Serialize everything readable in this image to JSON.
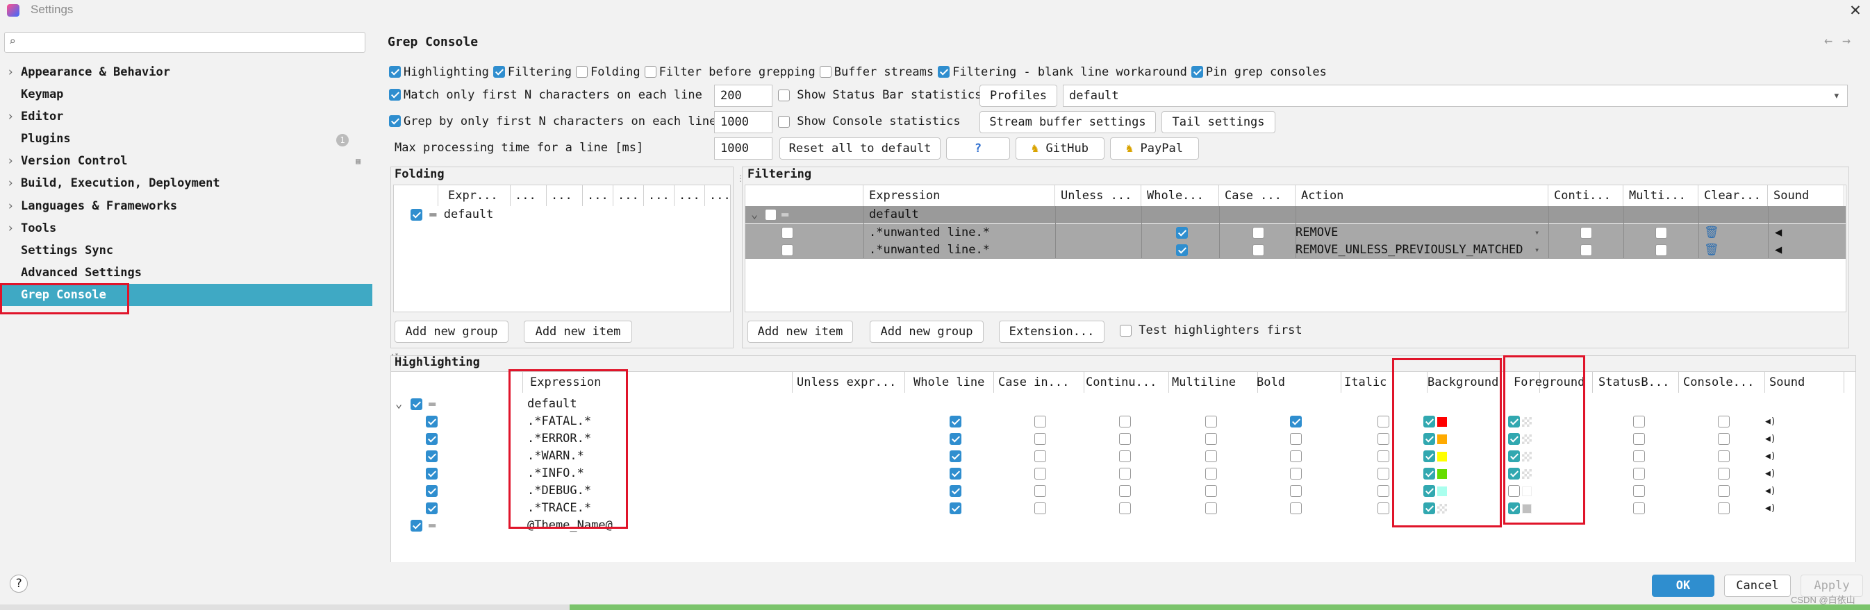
{
  "window": {
    "title": "Settings",
    "close": "✕"
  },
  "sidebar": {
    "search_placeholder": "",
    "items": [
      {
        "label": "Appearance & Behavior",
        "expandable": true
      },
      {
        "label": "Keymap",
        "expandable": false
      },
      {
        "label": "Editor",
        "expandable": true
      },
      {
        "label": "Plugins",
        "expandable": false,
        "badge": "1"
      },
      {
        "label": "Version Control",
        "expandable": true
      },
      {
        "label": "Build, Execution, Deployment",
        "expandable": true
      },
      {
        "label": "Languages & Frameworks",
        "expandable": true
      },
      {
        "label": "Tools",
        "expandable": true
      },
      {
        "label": "Settings Sync",
        "expandable": false
      },
      {
        "label": "Advanced Settings",
        "expandable": false
      },
      {
        "label": "Grep Console",
        "expandable": false,
        "selected": true
      }
    ]
  },
  "page": {
    "title": "Grep Console",
    "back": "←",
    "forward": "→"
  },
  "options": {
    "row1": [
      {
        "label": "Highlighting",
        "checked": true
      },
      {
        "label": "Filtering",
        "checked": true
      },
      {
        "label": "Folding",
        "checked": false
      },
      {
        "label": "Filter before grepping",
        "checked": false
      },
      {
        "label": "Buffer streams",
        "checked": false
      },
      {
        "label": "Filtering - blank line workaround",
        "checked": true
      },
      {
        "label": "Pin grep consoles",
        "checked": true
      }
    ],
    "match_first_n": {
      "label": "Match only first N characters on each line",
      "checked": true,
      "value": "200"
    },
    "grep_first_n": {
      "label": "Grep by only first N characters on each line",
      "checked": true,
      "value": "1000"
    },
    "max_time": {
      "label": "Max processing time for a line [ms]",
      "value": "1000"
    },
    "status_bar_stats": {
      "label": "Show Status Bar statistics",
      "checked": false
    },
    "console_stats": {
      "label": "Show Console statistics",
      "checked": false
    },
    "profiles_label": "Profiles",
    "profile_value": "default",
    "stream_buffer_btn": "Stream buffer settings",
    "tail_settings_btn": "Tail settings",
    "reset_btn": "Reset all to default",
    "help_btn": "?",
    "github_btn": "GitHub",
    "paypal_btn": "PayPal"
  },
  "folding": {
    "title": "Folding",
    "headers": [
      "Expr...",
      "...",
      "...",
      "...",
      "...",
      "...",
      "...",
      "..."
    ],
    "rows": [
      {
        "label": "default",
        "checked": true
      }
    ],
    "add_group": "Add new group",
    "add_item": "Add new item"
  },
  "filtering": {
    "title": "Filtering",
    "headers": [
      "Expression",
      "Unless ...",
      "Whole...",
      "Case ...",
      "Action",
      "Conti...",
      "Multi...",
      "Clear...",
      "Sound"
    ],
    "group": "default",
    "rows": [
      {
        "expression": ".*unwanted line.*",
        "whole": true,
        "case": false,
        "action": "REMOVE",
        "conti": false,
        "multi": false
      },
      {
        "expression": ".*unwanted line.*",
        "whole": true,
        "case": false,
        "action": "REMOVE_UNLESS_PREVIOUSLY_MATCHED",
        "conti": false,
        "multi": false
      }
    ],
    "add_item": "Add new item",
    "add_group": "Add new group",
    "extension": "Extension...",
    "test_first": {
      "label": "Test highlighters first",
      "checked": false
    }
  },
  "highlighting": {
    "title": "Highlighting",
    "headers": [
      "Expression",
      "Unless expr...",
      "Whole line",
      "Case in...",
      "Continu...",
      "Multiline",
      "Bold",
      "Italic",
      "Background",
      "Foreground",
      "StatusB...",
      "Console...",
      "Sound"
    ],
    "groups": [
      {
        "label": "default",
        "checked": true,
        "rows": [
          {
            "expression": ".*FATAL.*",
            "whole": true,
            "bold": true,
            "bg": "#ff0000",
            "bg_on": true,
            "fg_on": true,
            "fg": "checker"
          },
          {
            "expression": ".*ERROR.*",
            "whole": true,
            "bold": false,
            "bg": "#ffaa00",
            "bg_on": true,
            "fg_on": true,
            "fg": "checker"
          },
          {
            "expression": ".*WARN.*",
            "whole": true,
            "bold": false,
            "bg": "#ffff00",
            "bg_on": true,
            "fg_on": true,
            "fg": "checker"
          },
          {
            "expression": ".*INFO.*",
            "whole": true,
            "bold": false,
            "bg": "#66dd00",
            "bg_on": true,
            "fg_on": true,
            "fg": "checker"
          },
          {
            "expression": ".*DEBUG.*",
            "whole": true,
            "bold": false,
            "bg": "#aaffee",
            "bg_on": true,
            "fg_on": false,
            "fg": "#ffffff"
          },
          {
            "expression": ".*TRACE.*",
            "whole": true,
            "bold": false,
            "bg": "checker",
            "bg_on": true,
            "fg_on": true,
            "fg": "#c0c0c0"
          }
        ]
      },
      {
        "label": "@Theme_Name@",
        "checked": true,
        "rows": []
      }
    ]
  },
  "footer": {
    "help": "?",
    "ok": "OK",
    "cancel": "Cancel",
    "apply": "Apply",
    "watermark": "CSDN @白依山"
  },
  "colors": {
    "accent": "#3fa9c4",
    "checkbox": "#2f8ecf",
    "highlight": "#e0142a",
    "ok": "#2f8ecf"
  }
}
